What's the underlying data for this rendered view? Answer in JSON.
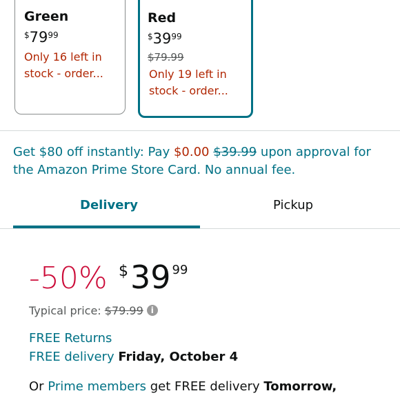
{
  "variants": [
    {
      "name": "Green",
      "price_currency": "$",
      "price_whole": "79",
      "price_cents": "99",
      "stock_line1": "Only 16 left in",
      "stock_line2": "stock - order..."
    },
    {
      "name": "Red",
      "price_currency": "$",
      "price_whole": "39",
      "price_cents": "99",
      "old_price": "$79.99",
      "stock_line1": "Only 19 left in",
      "stock_line2": "stock - order..."
    }
  ],
  "promo": {
    "part1": "Get $80 off instantly: Pay ",
    "pay_amount": "$0.00",
    "strike_amount": "$39.99",
    "part2": " upon approval for",
    "line2": "the Amazon Prime Store Card. No annual fee."
  },
  "tabs": [
    {
      "label": "Delivery",
      "active": true
    },
    {
      "label": "Pickup",
      "active": false
    }
  ],
  "price_block": {
    "discount": "-50%",
    "currency": "$",
    "whole": "39",
    "cents": "99",
    "typical_label": "Typical price: ",
    "typical_price": "$79.99",
    "info_icon": "i"
  },
  "delivery": {
    "free_returns": "FREE Returns",
    "free_delivery_link": "FREE delivery",
    "free_delivery_date": "Friday, October 4",
    "prime_prefix": "Or ",
    "prime_link": "Prime members",
    "prime_mid": " get FREE delivery ",
    "prime_date": "Tomorrow,"
  },
  "colors": {
    "accent": "#007185",
    "deal_red": "#cc0c39",
    "stock_red": "#b12704"
  }
}
